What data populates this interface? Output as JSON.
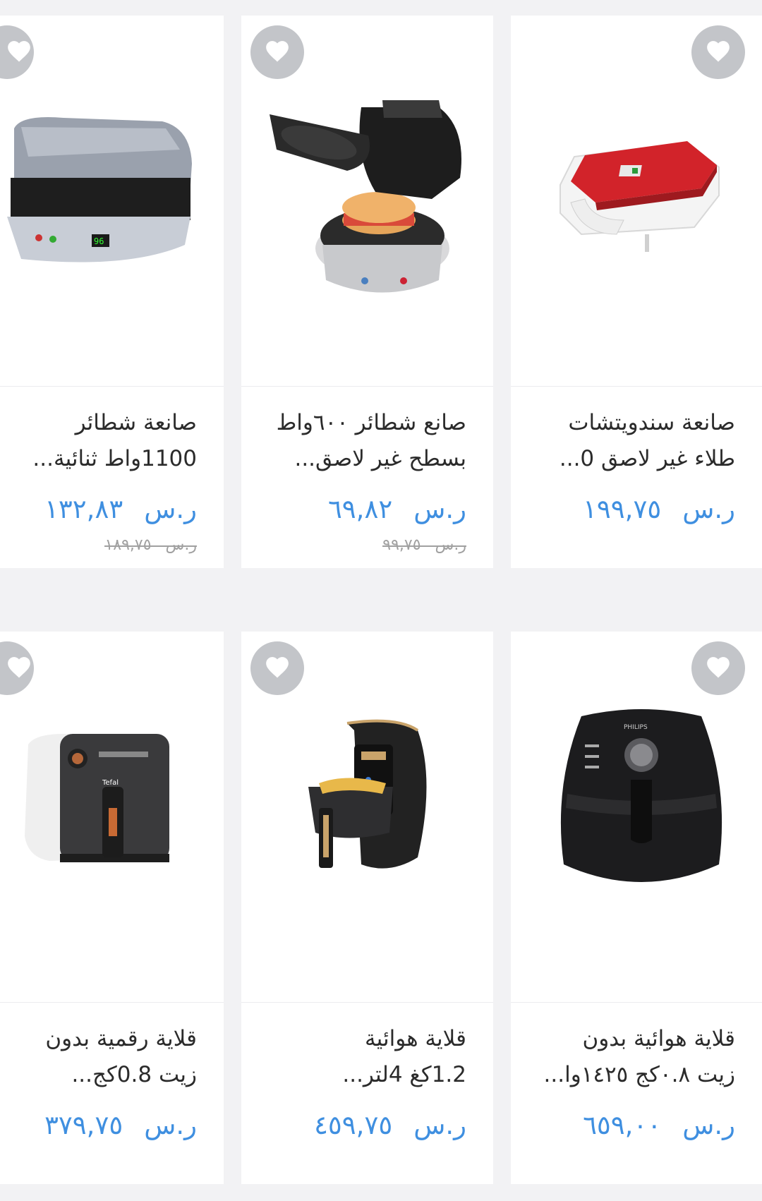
{
  "colors": {
    "background": "#f2f2f4",
    "price": "#3f8fe0",
    "favorite_bg": "#c3c5c9"
  },
  "rows": [
    {
      "products": [
        {
          "title_lines": [
            "صانعة سندويتشات",
            "طلاء غير لاصق 0..."
          ],
          "currency": "ر.س",
          "price": "١٩٩,٧٥",
          "old_currency": "",
          "old_price": "",
          "image": "red-sandwich-maker",
          "favorite_icon": "heart-icon"
        },
        {
          "title_lines": [
            "صانع شطائر ٦٠٠واط",
            "بسطح غير لاصق..."
          ],
          "currency": "ر.س",
          "price": "٦٩,٨٢",
          "old_currency": "ر.س",
          "old_price": "٩٩,٧٥",
          "image": "breakfast-sandwich-maker",
          "favorite_icon": "heart-icon"
        },
        {
          "title_lines": [
            "صانعة شطائر",
            "1100واط ثنائية..."
          ],
          "currency": "ر.س",
          "price": "١٣٢,٨٣",
          "old_currency": "ر.س",
          "old_price": "١٨٩,٧٥",
          "image": "dual-sandwich-maker",
          "favorite_icon": "heart-icon"
        }
      ]
    },
    {
      "products": [
        {
          "title_lines": [
            "قلاية هوائية بدون",
            "زيت ٠.٨كج ١٤٢٥وا..."
          ],
          "currency": "ر.س",
          "price": "٦٥٩,٠٠",
          "old_currency": "",
          "old_price": "",
          "image": "black-air-fryer",
          "favorite_icon": "heart-icon"
        },
        {
          "title_lines": [
            "قلاية هوائية",
            "1.2كغ 4لتر..."
          ],
          "currency": "ر.س",
          "price": "٤٥٩,٧٥",
          "old_currency": "",
          "old_price": "",
          "image": "digital-air-fryer-open",
          "favorite_icon": "heart-icon"
        },
        {
          "title_lines": [
            "قلاية رقمية بدون",
            "زيت 0.8كج..."
          ],
          "currency": "ر.س",
          "price": "٣٧٩,٧٥",
          "old_currency": "",
          "old_price": "",
          "image": "white-oil-free-fryer",
          "favorite_icon": "heart-icon"
        }
      ]
    }
  ]
}
